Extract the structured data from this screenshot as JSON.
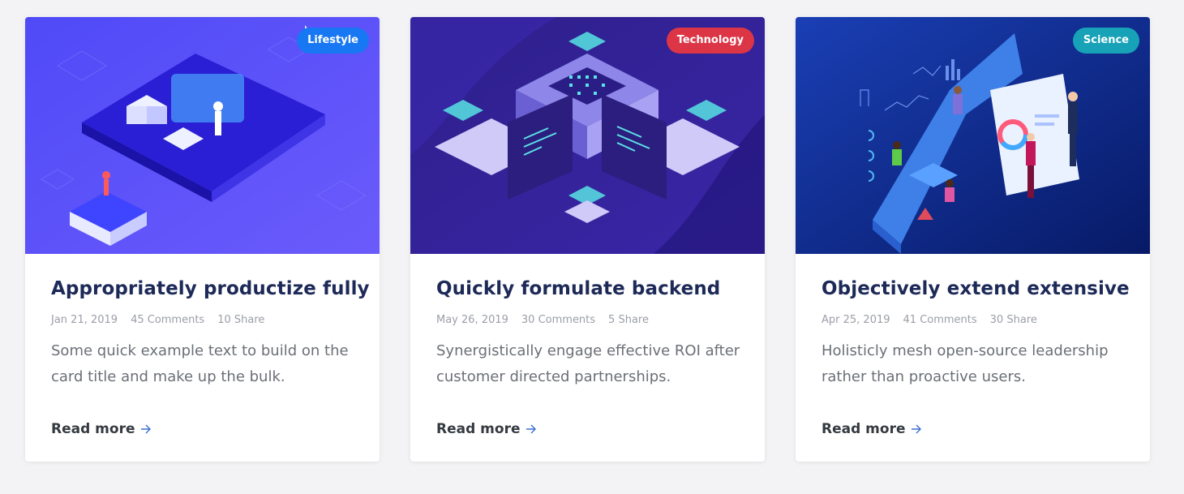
{
  "cards": [
    {
      "badge": "Lifestyle",
      "badge_color": "#1877f2",
      "title": "Appropriately productize fully",
      "date": "Jan 21, 2019",
      "comments": "45 Comments",
      "shares": "10 Share",
      "text": "Some quick example text to build on the card title and make up the bulk.",
      "read_more": "Read more",
      "image_theme": "#5a52f5"
    },
    {
      "badge": "Technology",
      "badge_color": "#dc3545",
      "title": "Quickly formulate backend",
      "date": "May 26, 2019",
      "comments": "30 Comments",
      "shares": "5 Share",
      "text": "Synergistically engage effective ROI after customer directed partnerships.",
      "read_more": "Read more",
      "image_theme": "#2f1e86"
    },
    {
      "badge": "Science",
      "badge_color": "#17a2b8",
      "title": "Objectively extend extensive",
      "date": "Apr 25, 2019",
      "comments": "41 Comments",
      "shares": "30 Share",
      "text": "Holisticly mesh open-source leadership rather than proactive users.",
      "read_more": "Read more",
      "image_theme": "#0c2b8a"
    }
  ],
  "icons": {
    "read_more": "arrow-right-icon"
  }
}
